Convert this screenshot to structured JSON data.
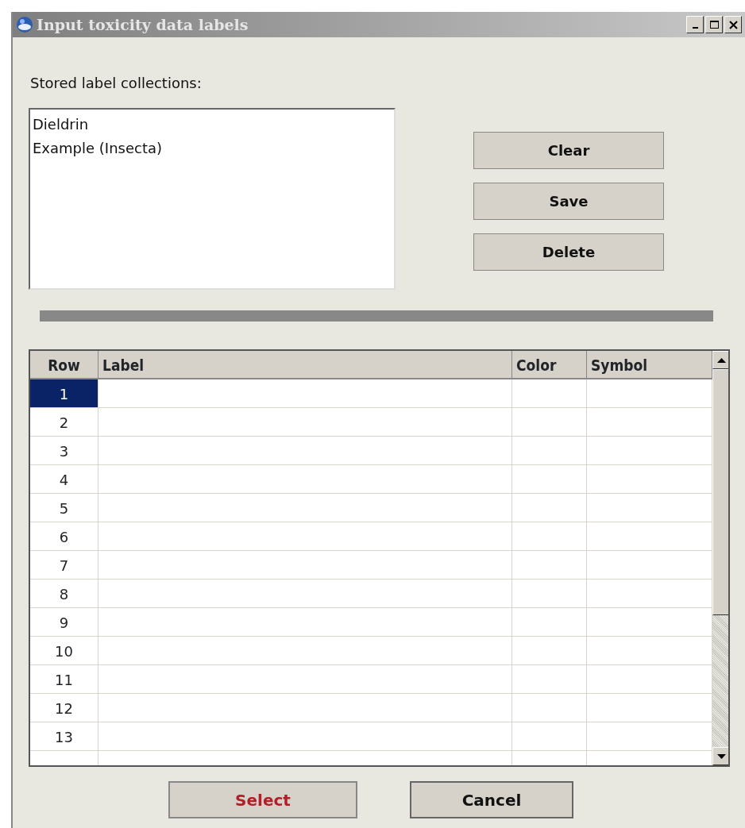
{
  "window": {
    "title": "Input toxicity data labels",
    "controls": [
      {
        "kind": "minimize"
      },
      {
        "kind": "maximize"
      },
      {
        "kind": "close"
      }
    ]
  },
  "collections": {
    "label": "Stored label collections:",
    "items": [
      {
        "text": "Dieldrin"
      },
      {
        "text": "Example (Insecta)"
      }
    ]
  },
  "side_buttons": [
    "Clear",
    "Save",
    "Delete"
  ],
  "table": {
    "columns": [
      "Row",
      "Label",
      "Color",
      "Symbol"
    ],
    "rows": [
      {
        "row": "1",
        "selected": true
      },
      {
        "row": "2",
        "selected": false
      },
      {
        "row": "3",
        "selected": false
      },
      {
        "row": "4",
        "selected": false
      },
      {
        "row": "5",
        "selected": false
      },
      {
        "row": "6",
        "selected": false
      },
      {
        "row": "7",
        "selected": false
      },
      {
        "row": "8",
        "selected": false
      },
      {
        "row": "9",
        "selected": false
      },
      {
        "row": "10",
        "selected": false
      },
      {
        "row": "11",
        "selected": false
      },
      {
        "row": "12",
        "selected": false
      },
      {
        "row": "13",
        "selected": false
      }
    ]
  },
  "footer_buttons": [
    {
      "text": "Select",
      "kind": "primary"
    },
    {
      "text": "Cancel",
      "kind": "normal"
    }
  ]
}
